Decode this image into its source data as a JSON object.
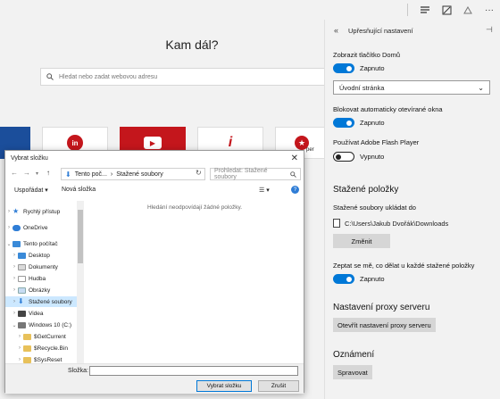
{
  "newtab": {
    "title": "Kam dál?",
    "search_placeholder": "Hledat nebo zadat webovou adresu",
    "tiles": [
      {
        "label": "in"
      },
      {
        "label": "▶"
      },
      {
        "label": "i"
      },
      {
        "label": "per"
      }
    ]
  },
  "dialog": {
    "title": "Vybrat složku",
    "breadcrumb_1": "Tento poč...",
    "breadcrumb_sep": "›",
    "breadcrumb_2": "Stažené soubory",
    "search_placeholder": "Prohledat: Stažené soubory",
    "organize_label": "Uspořádat ▾",
    "new_folder_label": "Nová složka",
    "empty_message": "Hledání neodpovídají žádné položky.",
    "tree": [
      {
        "label": "Rychlý přístup"
      },
      {
        "label": "OneDrive"
      },
      {
        "label": "Tento počítač"
      },
      {
        "label": "Desktop"
      },
      {
        "label": "Dokumenty"
      },
      {
        "label": "Hudba"
      },
      {
        "label": "Obrázky"
      },
      {
        "label": "Stažené soubory"
      },
      {
        "label": "Videa"
      },
      {
        "label": "Windows 10 (C:)"
      },
      {
        "label": "$GetCurrent"
      },
      {
        "label": "$Recycle.Bin"
      },
      {
        "label": "$SysReset"
      }
    ],
    "folder_label": "Složka:",
    "folder_value": "",
    "select_button": "Vybrat složku",
    "cancel_button": "Zrušit"
  },
  "panel": {
    "title": "Upřesňující nastavení",
    "home_button_label": "Zobrazit tlačítko Domů",
    "home_button_state": "Zapnuto",
    "home_select_value": "Úvodní stránka",
    "popups_label": "Blokovat automaticky otevírané okna",
    "popups_state": "Zapnuto",
    "flash_label": "Používat Adobe Flash Player",
    "flash_state": "Vypnuto",
    "downloads_section": "Stažené položky",
    "save_to_label": "Stažené soubory ukládat do",
    "download_path": "C:\\Users\\Jakub Dvořák\\Downloads",
    "change_button": "Změnit",
    "ask_label": "Zeptat se mě, co dělat u každé stažené položky",
    "ask_state": "Zapnuto",
    "proxy_section": "Nastavení proxy serveru",
    "proxy_button": "Otevřít nastavení proxy serveru",
    "notifications_section": "Oznámení",
    "manage_button": "Spravovat"
  },
  "colors": {
    "accent": "#0078d7",
    "selection": "#cce8ff"
  }
}
